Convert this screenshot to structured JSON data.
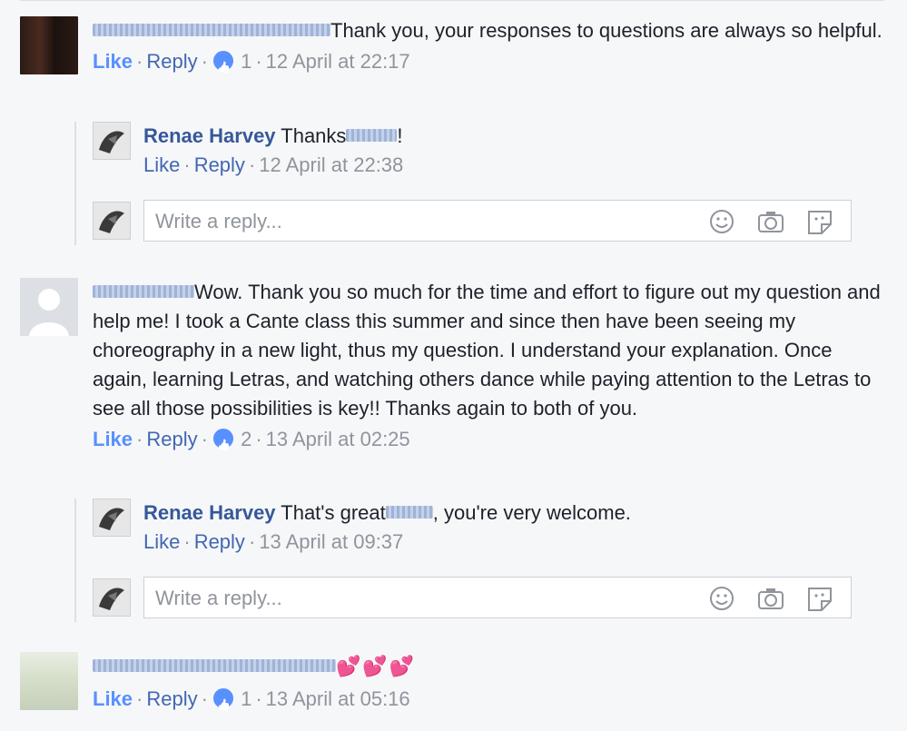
{
  "comments": [
    {
      "text": "Thank you, your responses to questions are always so helpful.",
      "actions": {
        "like": "Like",
        "reply": "Reply",
        "like_count": "1",
        "time": "12 April at 22:17"
      },
      "replies": [
        {
          "name": "Renae Harvey",
          "text_before": "Thanks",
          "text_after": "!",
          "actions": {
            "like": "Like",
            "reply": "Reply",
            "time": "12 April at 22:38"
          }
        }
      ],
      "write_reply_placeholder": "Write a reply..."
    },
    {
      "text": "Wow. Thank you so much for the time and effort to figure out my question and help me! I took a Cante class this summer and since then have been seeing my choreography in a new light, thus my question. I understand your explanation. Once again, learning Letras, and watching others dance while paying attention to the Letras to see all those possibilities is key!! Thanks again to both of you.",
      "actions": {
        "like": "Like",
        "reply": "Reply",
        "like_count": "2",
        "time": "13 April at 02:25"
      },
      "replies": [
        {
          "name": "Renae Harvey",
          "text_before": "That's great",
          "text_after": ", you're very welcome.",
          "actions": {
            "like": "Like",
            "reply": "Reply",
            "time": "13 April at 09:37"
          }
        }
      ],
      "write_reply_placeholder": "Write a reply..."
    },
    {
      "text": "💕💕💕",
      "actions": {
        "like": "Like",
        "reply": "Reply",
        "like_count": "1",
        "time": "13 April at 05:16"
      }
    }
  ],
  "icons": {
    "emoji": "smiley-icon",
    "camera": "camera-icon",
    "sticker": "sticker-icon",
    "like_badge": "thumbs-up-icon"
  },
  "colors": {
    "link": "#4267b2",
    "like": "#5890ff",
    "name": "#365899",
    "muted": "#90949c",
    "background": "#f6f7f9"
  }
}
